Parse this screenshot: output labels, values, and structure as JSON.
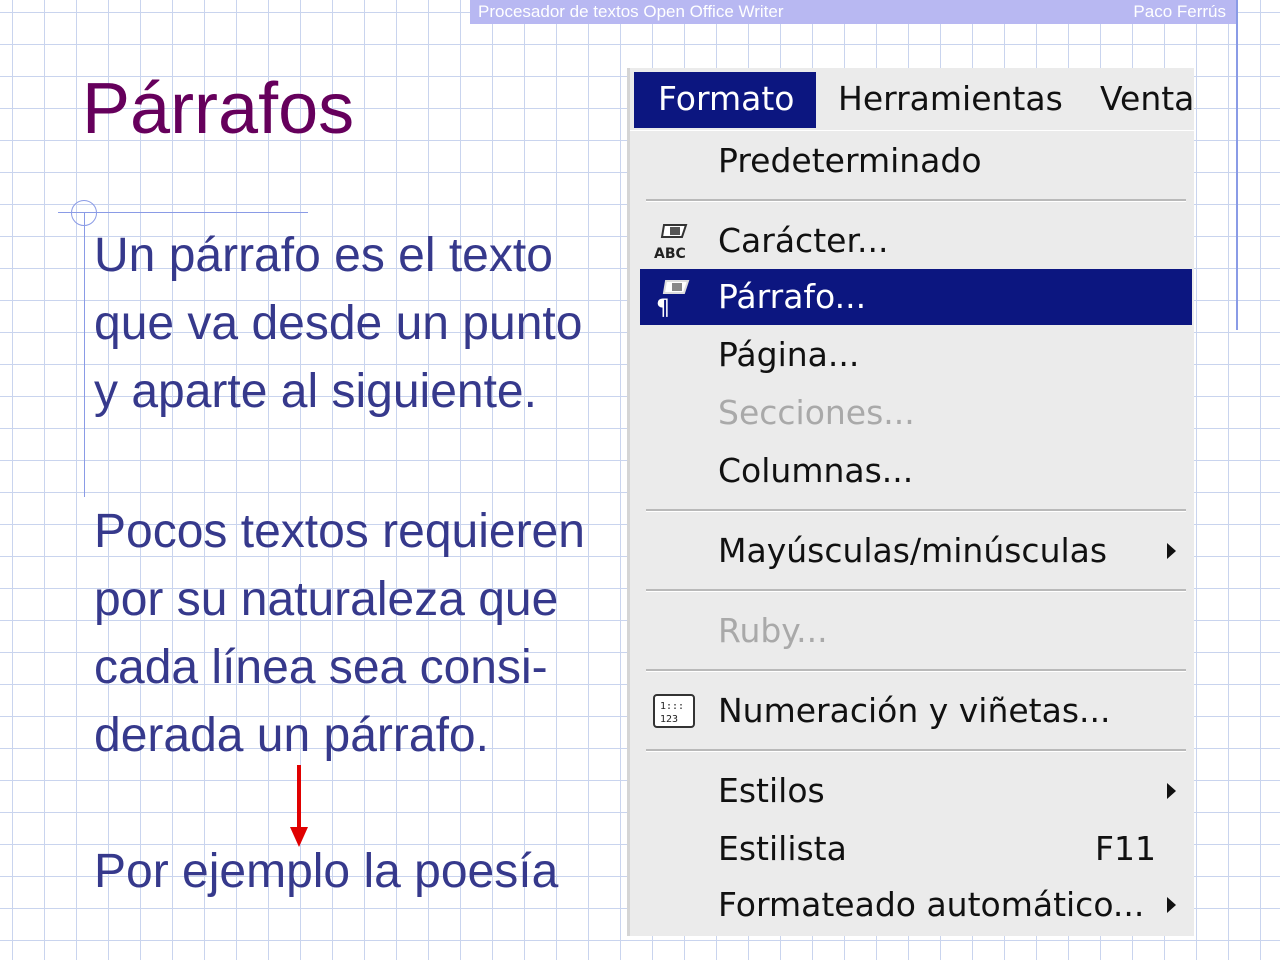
{
  "header": {
    "left_text": "Procesador de textos Open Office Writer",
    "right_text": "Paco Ferrús"
  },
  "slide": {
    "title": "Párrafos",
    "paragraph1": [
      "Un párrafo es el texto",
      "que va desde un punto",
      "y aparte al siguiente."
    ],
    "paragraph2": [
      "Pocos textos requieren",
      "por su naturaleza que",
      "cada línea sea consi-",
      "derada un párrafo."
    ],
    "paragraph3": [
      "Por ejemplo la poesía"
    ]
  },
  "menu": {
    "menubar": {
      "formato": "Formato",
      "herramientas": "Herramientas",
      "ventana": "Venta"
    },
    "items": {
      "predeterminado": "Predeterminado",
      "caracter": "Carácter...",
      "parrafo": "Párrafo...",
      "pagina": "Página...",
      "secciones": "Secciones...",
      "columnas": "Columnas...",
      "mayusculas": "Mayúsculas/minúsculas",
      "ruby": "Ruby...",
      "numeracion": "Numeración y viñetas...",
      "estilos": "Estilos",
      "estilista": "Estilista",
      "estilista_shortcut": "F11",
      "formateado": "Formateado automático..."
    },
    "selected_item": "Párrafo...",
    "disabled_items": [
      "Secciones...",
      "Ruby..."
    ]
  },
  "colors": {
    "title": "#66005c",
    "body_text": "#36398c",
    "menu_highlight": "#0c1680",
    "header_bar": "#b8b8f2",
    "arrow": "#e00000"
  }
}
